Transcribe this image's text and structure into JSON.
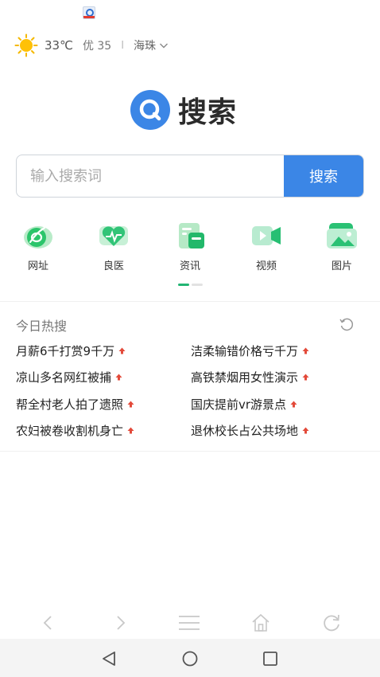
{
  "weather": {
    "temperature": "33℃",
    "air_quality": "优 35",
    "separator": "I",
    "location": "海珠"
  },
  "logo": {
    "text": "搜索"
  },
  "search": {
    "placeholder": "输入搜索词",
    "button_label": "搜索"
  },
  "quick_nav": [
    {
      "label": "网址",
      "icon": "globe-link-icon"
    },
    {
      "label": "良医",
      "icon": "health-heart-icon"
    },
    {
      "label": "资讯",
      "icon": "news-icon"
    },
    {
      "label": "视频",
      "icon": "video-camera-icon"
    },
    {
      "label": "图片",
      "icon": "picture-icon"
    }
  ],
  "hot_search": {
    "title": "今日热搜",
    "items": [
      "月薪6千打赏9千万",
      "洁柔输错价格亏千万",
      "凉山多名网红被捕",
      "高铁禁烟用女性演示",
      "帮全村老人拍了遗照",
      "国庆提前vr游景点",
      "农妇被卷收割机身亡",
      "退休校长占公共场地"
    ]
  },
  "colors": {
    "accent_blue": "#3b86e6",
    "accent_green": "#22b573",
    "hot_arrow": "#e34a3a"
  }
}
